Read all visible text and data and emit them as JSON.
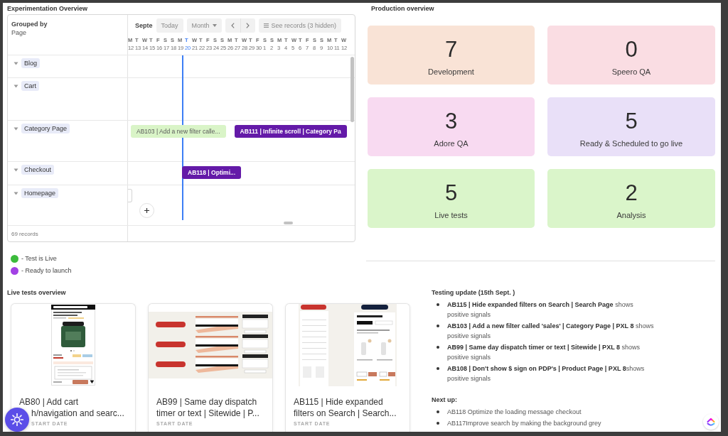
{
  "experimentation_overview": {
    "title": "Experimentation Overview",
    "grouped_by": {
      "label": "Grouped by",
      "value": "Page"
    },
    "month": "Septe",
    "toolbar": [
      {
        "kind": "button",
        "label": "Today"
      },
      {
        "kind": "dropdown",
        "label": "Month"
      },
      {
        "kind": "pager"
      },
      {
        "kind": "records",
        "label": "See records (3 hidden)"
      }
    ],
    "days": [
      {
        "weekday": "M",
        "date": "12",
        "today": false
      },
      {
        "weekday": "T",
        "date": "13",
        "today": false
      },
      {
        "weekday": "W",
        "date": "14",
        "today": false
      },
      {
        "weekday": "T",
        "date": "15",
        "today": false
      },
      {
        "weekday": "F",
        "date": "16",
        "today": false
      },
      {
        "weekday": "S",
        "date": "17",
        "today": false
      },
      {
        "weekday": "S",
        "date": "18",
        "today": false
      },
      {
        "weekday": "M",
        "date": "19",
        "today": false
      },
      {
        "weekday": "T",
        "date": "20",
        "today": true
      },
      {
        "weekday": "W",
        "date": "21",
        "today": false
      },
      {
        "weekday": "T",
        "date": "22",
        "today": false
      },
      {
        "weekday": "F",
        "date": "23",
        "today": false
      },
      {
        "weekday": "S",
        "date": "24",
        "today": false
      },
      {
        "weekday": "S",
        "date": "25",
        "today": false
      },
      {
        "weekday": "M",
        "date": "26",
        "today": false
      },
      {
        "weekday": "T",
        "date": "27",
        "today": false
      },
      {
        "weekday": "W",
        "date": "28",
        "today": false
      },
      {
        "weekday": "T",
        "date": "29",
        "today": false
      },
      {
        "weekday": "F",
        "date": "30",
        "today": false
      },
      {
        "weekday": "S",
        "date": "1",
        "today": false
      },
      {
        "weekday": "S",
        "date": "2",
        "today": false
      },
      {
        "weekday": "M",
        "date": "3",
        "today": false
      },
      {
        "weekday": "T",
        "date": "4",
        "today": false
      },
      {
        "weekday": "W",
        "date": "5",
        "today": false
      },
      {
        "weekday": "T",
        "date": "6",
        "today": false
      },
      {
        "weekday": "F",
        "date": "7",
        "today": false
      },
      {
        "weekday": "S",
        "date": "8",
        "today": false
      },
      {
        "weekday": "S",
        "date": "9",
        "today": false
      },
      {
        "weekday": "M",
        "date": "10",
        "today": false
      },
      {
        "weekday": "T",
        "date": "11",
        "today": false
      },
      {
        "weekday": "W",
        "date": "12",
        "today": false
      }
    ],
    "groups": [
      {
        "name": "Blog",
        "expanded": true,
        "hovered": false
      },
      {
        "name": "Cart",
        "expanded": true,
        "hovered": false
      },
      {
        "name": "Category Page",
        "expanded": true,
        "hovered": false,
        "bars": [
          {
            "kind": "live",
            "label": "AB103 | Add a new filter calle...",
            "starts_today": false
          },
          {
            "kind": "ready",
            "label": "AB111 | Infinite scroll | Category Pa",
            "starts_today": false
          }
        ]
      },
      {
        "name": "Checkout",
        "expanded": true,
        "hovered": false,
        "bars": [
          {
            "kind": "ready",
            "label": "AB118 | Optimi...",
            "starts_today": true
          }
        ]
      },
      {
        "name": "Homepage",
        "expanded": true,
        "hovered": true,
        "bars": [
          {
            "kind": "stub"
          }
        ]
      }
    ],
    "footer": "69 records"
  },
  "legend": [
    {
      "color": "#3cbb3c",
      "label": "- Test is Live"
    },
    {
      "color": "#a241e4",
      "label": "- Ready to launch"
    }
  ],
  "production_overview": {
    "title": "Production overview",
    "stages": [
      {
        "count": "7",
        "label": "Development",
        "color": "#f9e3d6"
      },
      {
        "count": "0",
        "label": "Speero QA",
        "color": "#fadde3"
      },
      {
        "count": "3",
        "label": "Adore QA",
        "color": "#f8daf1"
      },
      {
        "count": "5",
        "label": "Ready & Scheduled to go live",
        "color": "#e9e0f8"
      },
      {
        "count": "5",
        "label": "Live tests",
        "color": "#daf5ca"
      },
      {
        "count": "2",
        "label": "Analysis",
        "color": "#daf5ca"
      }
    ]
  },
  "live_tests": {
    "title": "Live tests overview",
    "cards": [
      {
        "kind": "phone",
        "lines": [
          "AB80 | Add cart",
          "h/navigation and searc..."
        ],
        "date_label": "START DATE"
      },
      {
        "kind": "banners",
        "lines": [
          "AB99 | Same day dispatch",
          "timer or text | Sitewide | P..."
        ],
        "date_label": "START DATE"
      },
      {
        "kind": "split",
        "lines": [
          "AB115 | Hide expanded",
          "filters on Search | Search..."
        ],
        "date_label": "START DATE"
      }
    ]
  },
  "testing_update": {
    "title": "Testing update (15th Sept. )",
    "items": [
      "**AB115 | Hide expanded filters on Search | Search Page** shows positive signals",
      "**AB103 | Add a new filter called 'sales' | Category Page | PXL 8** shows positive signals",
      "**AB99 | Same day dispatch timer or text | Sitewide | PXL 8** shows positive signals",
      "**AB108 | Don't show $ sign on PDP's | Product Page | PXL 8**shows positive signals"
    ]
  },
  "next_up": {
    "title": "Next up:",
    "items": [
      "AB118 Optimize the loading message checkout",
      "AB117Improve search by making the background grey"
    ]
  }
}
